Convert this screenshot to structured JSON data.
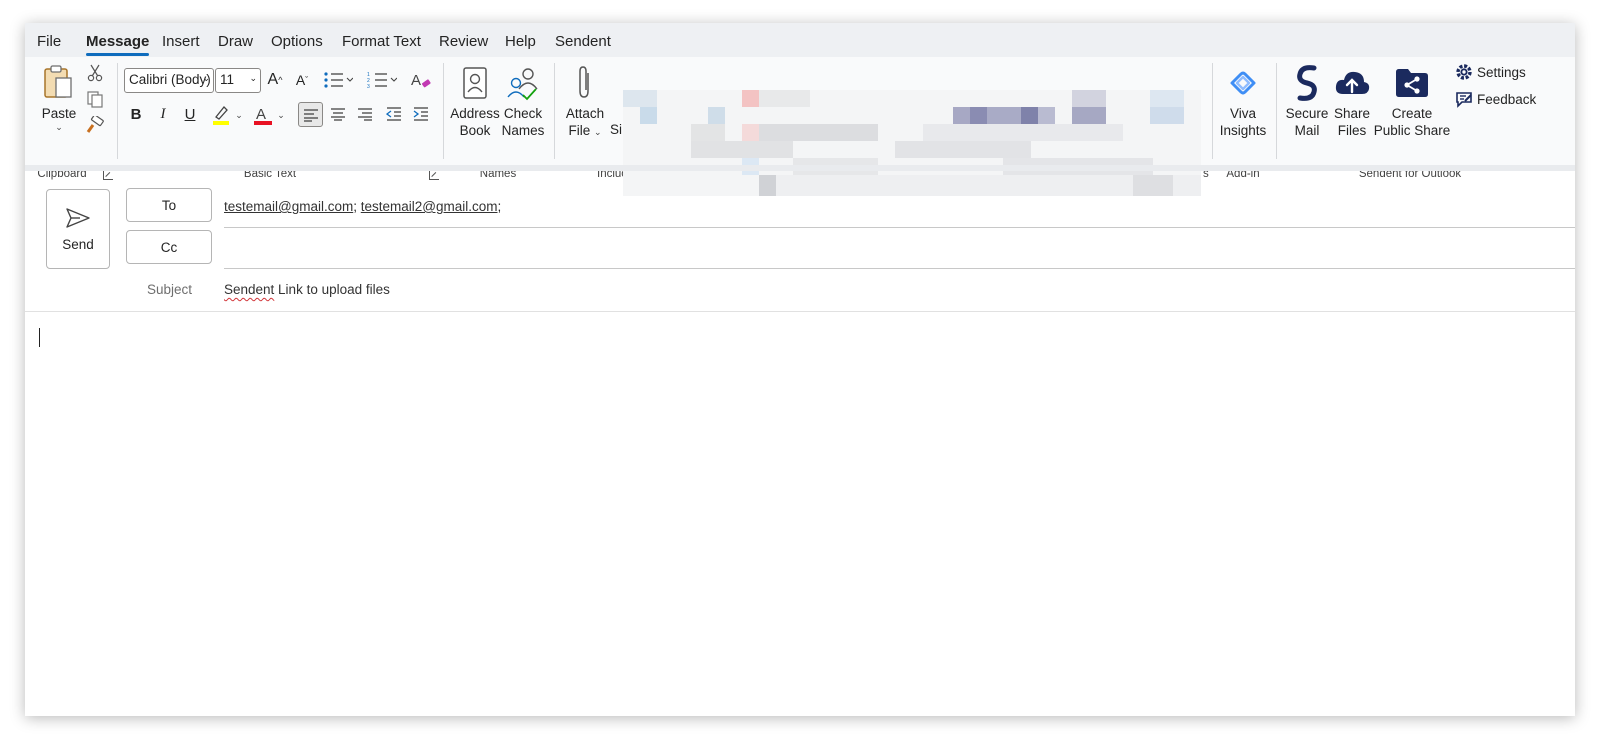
{
  "menu": {
    "tabs": [
      "File",
      "Message",
      "Insert",
      "Draw",
      "Options",
      "Format Text",
      "Review",
      "Help",
      "Sendent"
    ],
    "active": "Message"
  },
  "ribbon": {
    "clipboard": {
      "label": "Clipboard",
      "paste": "Paste"
    },
    "basic_text": {
      "label": "Basic Text",
      "font": "Calibri (Body)",
      "size": "11"
    },
    "names": {
      "label": "Names",
      "address_book": [
        "Address",
        "Book"
      ],
      "check_names": [
        "Check",
        "Names"
      ]
    },
    "include": {
      "label_partial": "Incluc",
      "attach_file": [
        "Attach",
        "File"
      ],
      "signature_partial": "Si"
    },
    "hidden_group_tail": "s",
    "addin": {
      "label": "Add-in",
      "viva": [
        "Viva",
        "Insights"
      ]
    },
    "sendent": {
      "label": "Sendent for Outlook",
      "secure_mail": [
        "Secure",
        "Mail"
      ],
      "share_files": [
        "Share",
        "Files"
      ],
      "public_share": [
        "Create",
        "Public Share"
      ],
      "settings": "Settings",
      "feedback": "Feedback"
    }
  },
  "compose": {
    "send": "Send",
    "to_label": "To",
    "cc_label": "Cc",
    "recipients": [
      "testemail@gmail.com",
      "testemail2@gmail.com"
    ],
    "subject_label": "Subject",
    "subject_first": "Sendent",
    "subject_rest": " Link to upload files"
  },
  "colors": {
    "accent": "#0f6cbd",
    "sendent_navy": "#1b2a5e",
    "viva_blue": "#3f8ef5",
    "highlight_yellow": "#ffff00",
    "font_red": "#e81123"
  }
}
